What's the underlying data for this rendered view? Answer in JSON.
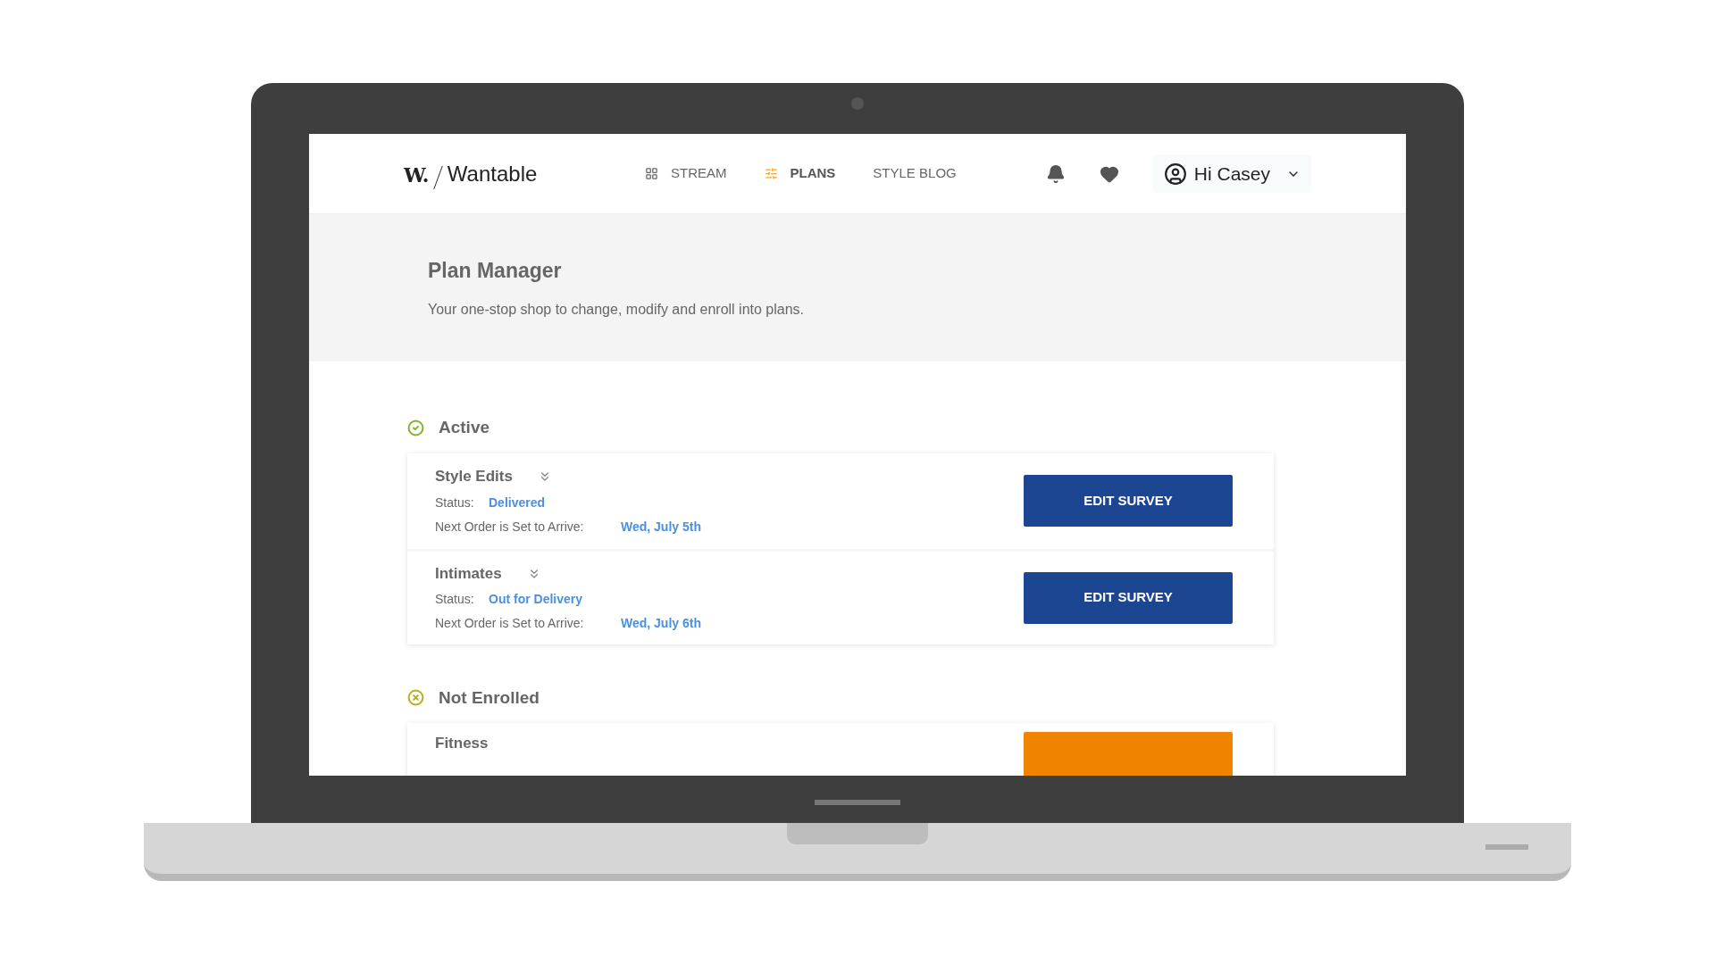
{
  "header": {
    "logo_mark": "W.",
    "logo_text": "Wantable",
    "nav": [
      {
        "label": "STREAM",
        "kind": "grid",
        "selected": false
      },
      {
        "label": "PLANS",
        "kind": "sliders",
        "selected": true
      },
      {
        "label": "STYLE BLOG",
        "selected": false
      }
    ],
    "greeting": "Hi Casey"
  },
  "hero": {
    "title": "Plan Manager",
    "subtitle": "Your one-stop shop to change, modify and enroll into plans."
  },
  "sections": [
    {
      "title": "Active",
      "kind": "active",
      "plans": [
        {
          "name": "Style Edits",
          "status_label": "Status:",
          "status": "Delivered",
          "next_label": "Next Order is Set to Arrive:",
          "next_date": "Wed, July 5th",
          "button": {
            "kind": "edit",
            "label": "EDIT SURVEY"
          }
        },
        {
          "name": "Intimates",
          "status_label": "Status:",
          "status": "Out for Delivery",
          "next_label": "Next Order is Set to Arrive:",
          "next_date": "Wed, July 6th",
          "button": {
            "kind": "edit",
            "label": "EDIT SURVEY"
          }
        }
      ]
    },
    {
      "title": "Not Enrolled",
      "kind": "not_enrolled",
      "plans": [
        {
          "name": "Fitness",
          "button": {
            "kind": "enroll"
          }
        }
      ]
    }
  ]
}
